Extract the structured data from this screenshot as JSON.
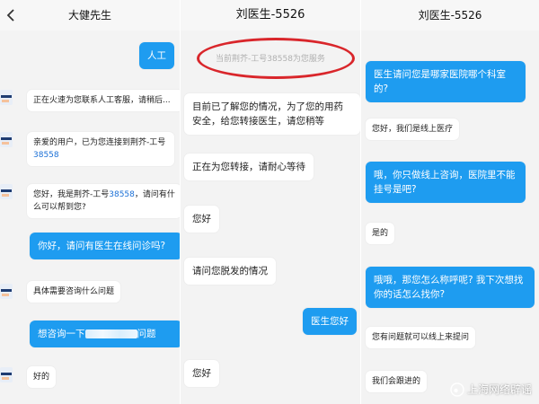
{
  "panel1": {
    "title": "大健先生",
    "messages": [
      {
        "text": "人工"
      },
      {
        "text": "正在火速为您联系人工客服，请稍后..."
      },
      {
        "text_a": "亲爱的用户，已为您连接到荆芥-工号",
        "num": "38558"
      },
      {
        "text_a": "您好，我是荆芥-工号",
        "num": "38558",
        "text_b": "，请问有什么可以帮到您?"
      },
      {
        "text": "你好，请问有医生在线问诊吗?"
      },
      {
        "text": "具体需要咨询什么问题"
      },
      {
        "text_a": "想咨询一下",
        "text_b": "问题"
      },
      {
        "text": "好的"
      }
    ]
  },
  "panel2": {
    "title": "刘医生-5526",
    "system_notice": "当前荆芥-工号38558为您服务",
    "messages": [
      {
        "text": "目前已了解您的情况，为了您的用药安全，给您转接医生，请您稍等"
      },
      {
        "text": "正在为您转接，请耐心等待"
      },
      {
        "text": "您好"
      },
      {
        "text": "请问您脱发的情况"
      },
      {
        "text": "医生您好"
      },
      {
        "text": "您好"
      }
    ]
  },
  "panel3": {
    "title": "刘医生-5526",
    "messages": [
      {
        "text": "医生请问您是哪家医院哪个科室的?"
      },
      {
        "text": "您好，我们是线上医疗"
      },
      {
        "text": "哦，你只做线上咨询，医院里不能挂号是吧?"
      },
      {
        "text": "是的"
      },
      {
        "text": "哦哦，那您怎么称呼呢? 我下次想找你的话怎么找你?"
      },
      {
        "text": "您有问题就可以线上来提问"
      },
      {
        "text": "我们会跟进的"
      }
    ]
  },
  "watermark": {
    "text": "上海网络辟谣"
  },
  "colors": {
    "sent_bubble": "#1e9cf0",
    "number_link": "#1a6fd6",
    "annotation_circle": "#d9262b"
  }
}
